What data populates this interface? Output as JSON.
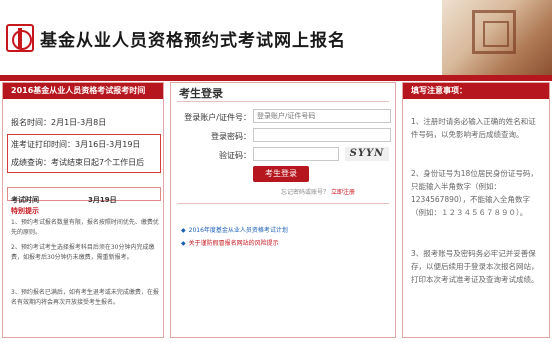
{
  "header": {
    "site_title": "基金从业人员资格预约式考试网上报名"
  },
  "left": {
    "heading": "2016基金从业人员资格考试报考时间",
    "registration": "报名时间：2月1日-3月8日",
    "admission": "准考证打印时间：3月16日-3月19日",
    "results": "成绩查询：考试结束日起7个工作日后",
    "exam_label": "考试时间",
    "exam_date": "3月19日",
    "special_title": "特别提示",
    "notes": [
      "1、预约考试报名数量有限，报名按照时间优先、缴费优先的原则。",
      "2、预约考试考生选择报考科目后须在30分钟内完成缴费，如报考后30分钟仍未缴费，需重新报考。",
      "3、预约报名已满后，如有考生退考或未完成缴费，在报名有效期内将会再次开放接受考生报名。"
    ]
  },
  "login": {
    "title": "考生登录",
    "account_label": "登录账户/证件号：",
    "account_placeholder": "登录账户/证件号码",
    "password_label": "登录密码：",
    "captcha_label": "验证码：",
    "captcha_text": "SYYN",
    "login_button": "考生登录",
    "forgot_question": "忘记密码或账号？",
    "register_link": "立即注册",
    "news": [
      "2016年度基金从业人员资格考试计划",
      "关于谨防假冒报名网站的风险提示"
    ]
  },
  "notice": {
    "heading": "填写注意事项：",
    "items": [
      "1、注册时请务必输入正确的姓名和证件号码，以免影响考后成绩查询。",
      "2、身份证号为18位居民身份证号码，只能输入半角数字（例如：1234567890），不能输入全角数字（例如：１２３４５６７８９０）。",
      "3、报考账号及密码务必牢记并妥善保存，以便后续用于登录本次报名网站，打印本次考试准考证及查询考试成绩。"
    ]
  },
  "colors": {
    "brand_red": "#b6161e",
    "link_blue": "#1a5fb4"
  }
}
